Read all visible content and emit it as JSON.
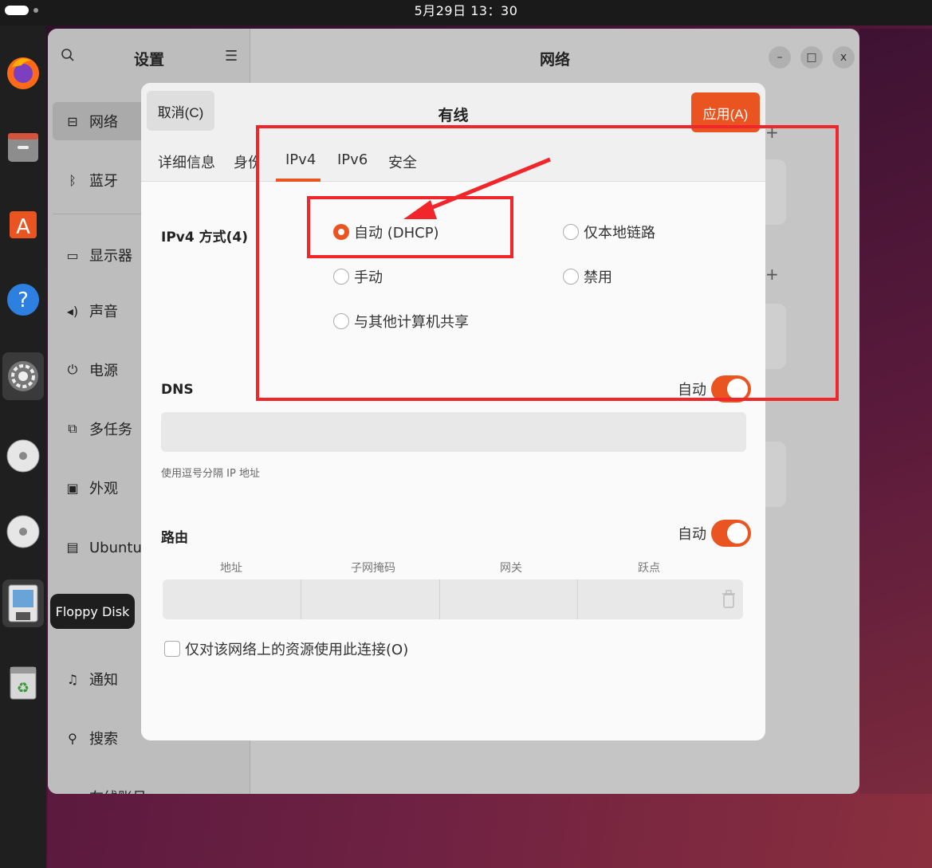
{
  "topbar": {
    "clock": "5月29日 13：30"
  },
  "tooltip": {
    "label": "Floppy Disk"
  },
  "settings": {
    "sidebar_title": "设置",
    "main_title": "网络",
    "sidebar": [
      {
        "label": "网络",
        "icon": "network-icon"
      },
      {
        "label": "蓝牙",
        "icon": "bluetooth-icon"
      },
      {
        "label": "显示器",
        "icon": "display-icon"
      },
      {
        "label": "声音",
        "icon": "sound-icon"
      },
      {
        "label": "电源",
        "icon": "power-icon"
      },
      {
        "label": "多任务",
        "icon": "multitask-icon"
      },
      {
        "label": "外观",
        "icon": "appearance-icon"
      },
      {
        "label": "Ubuntu 桌",
        "icon": "ubuntu-desktop-icon"
      },
      {
        "label": "通知",
        "icon": "bell-icon"
      },
      {
        "label": "搜索",
        "icon": "search-icon"
      },
      {
        "label": "在线账号",
        "icon": "online-accounts-icon"
      }
    ],
    "window_buttons": {
      "minimize": "–",
      "maximize": "□",
      "close": "x"
    }
  },
  "dialog": {
    "title": "有线",
    "cancel_label": "取消(C)",
    "apply_label": "应用(A)",
    "tabs": [
      "详细信息",
      "身份",
      "IPv4",
      "IPv6",
      "安全"
    ],
    "active_tab": "IPv4",
    "ipv4_method_label": "IPv4 方式(4)",
    "methods": {
      "auto": "自动 (DHCP)",
      "link_local": "仅本地链路",
      "manual": "手动",
      "disabled": "禁用",
      "shared": "与其他计算机共享"
    },
    "selected_method": "auto",
    "dns_label": "DNS",
    "dns_auto_label": "自动",
    "dns_auto_on": true,
    "dns_value": "",
    "dns_hint": "使用逗号分隔 IP 地址",
    "routes_label": "路由",
    "routes_auto_label": "自动",
    "routes_auto_on": true,
    "route_columns": [
      "地址",
      "子网掩码",
      "网关",
      "跃点"
    ],
    "only_local_label": "仅对该网络上的资源使用此连接(O)"
  },
  "colors": {
    "accent": "#e95420",
    "annotation": "#f0262b"
  }
}
